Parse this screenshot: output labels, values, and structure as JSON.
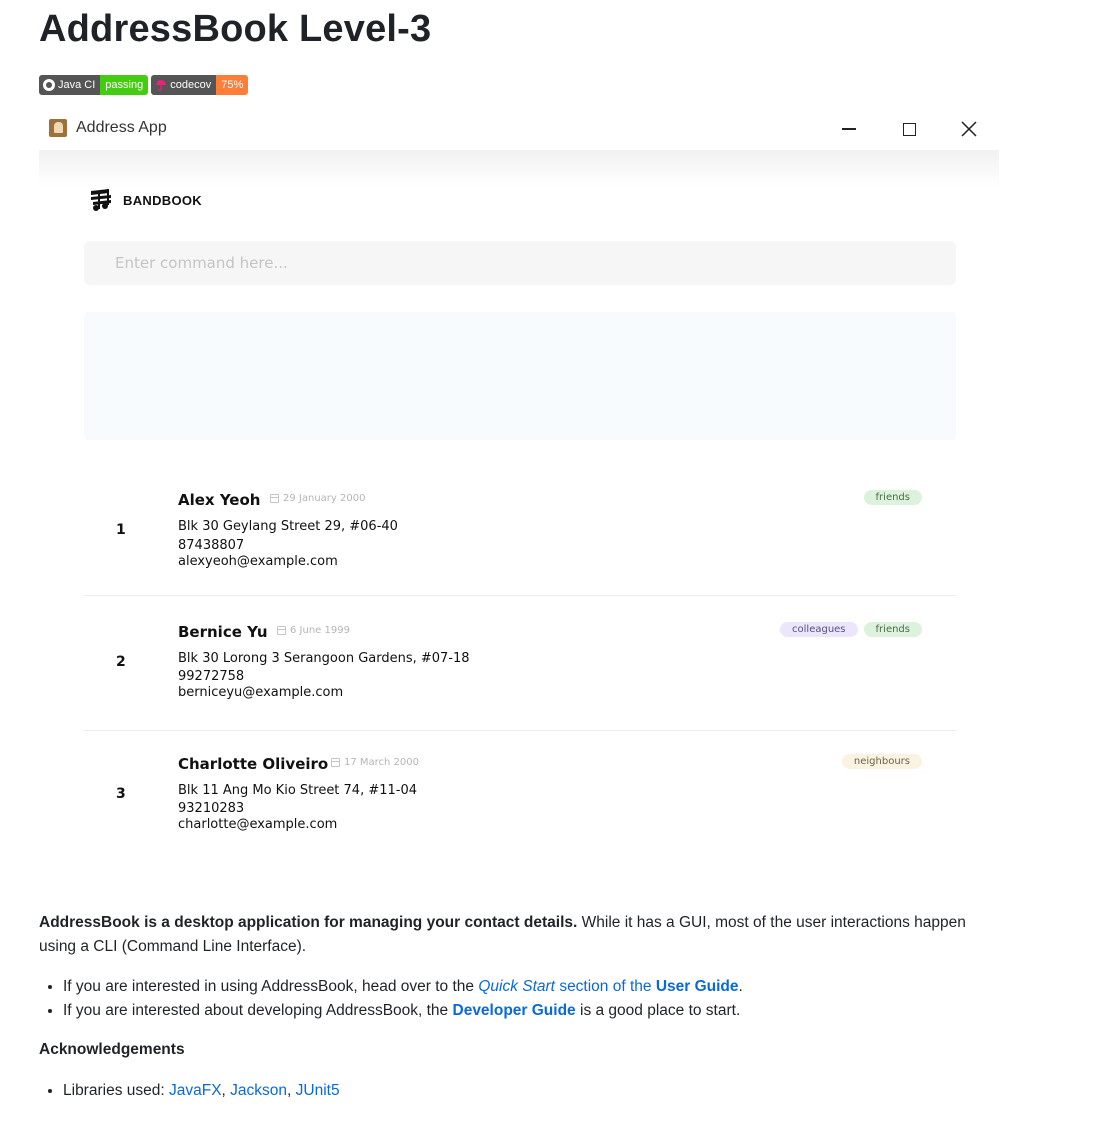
{
  "title": "AddressBook Level-3",
  "badges": [
    {
      "label": "Java CI",
      "status": "passing",
      "color": "#4c1"
    },
    {
      "label": "codecov",
      "status": "75%",
      "color": "#fe7d37"
    }
  ],
  "window": {
    "title": "Address App",
    "icon": "address-book-icon"
  },
  "brand": {
    "name": "BANDBOOK",
    "icon": "music-notes-icon"
  },
  "command": {
    "placeholder": "Enter command here...",
    "value": ""
  },
  "persons": [
    {
      "index": "1",
      "name": "Alex Yeoh",
      "birthday": "29 January 2000",
      "address": "Blk 30 Geylang Street 29, #06-40",
      "phone": "87438807",
      "email": "alexyeoh@example.com",
      "tags": [
        "friends"
      ]
    },
    {
      "index": "2",
      "name": "Bernice Yu",
      "birthday": "6 June 1999",
      "address": "Blk 30 Lorong 3 Serangoon Gardens, #07-18",
      "phone": "99272758",
      "email": "berniceyu@example.com",
      "tags": [
        "colleagues",
        "friends"
      ]
    },
    {
      "index": "3",
      "name": "Charlotte Oliveiro",
      "birthday": "17 March 2000",
      "address": "Blk 11 Ang Mo Kio Street 74, #11-04",
      "phone": "93210283",
      "email": "charlotte@example.com",
      "tags": [
        "neighbours"
      ]
    }
  ],
  "readme": {
    "intro_bold": "AddressBook is a desktop application for managing your contact details.",
    "intro_rest": "While it has a GUI, most of the user interactions happen using a CLI (Command Line Interface).",
    "bullet1_pre": "If you are interested in using AddressBook, head over to the",
    "bullet1_link_italic": "Quick Start",
    "bullet1_link_mid": "section of the",
    "bullet1_link_bold": "User Guide",
    "bullet1_post": ".",
    "bullet2_pre": "If you are interested about developing AddressBook, the",
    "bullet2_link": "Developer Guide",
    "bullet2_post": "is a good place to start.",
    "ack_heading": "Acknowledgements",
    "libs_pre": "Libraries used:",
    "libs": [
      "JavaFX",
      "Jackson",
      "JUnit5"
    ]
  }
}
